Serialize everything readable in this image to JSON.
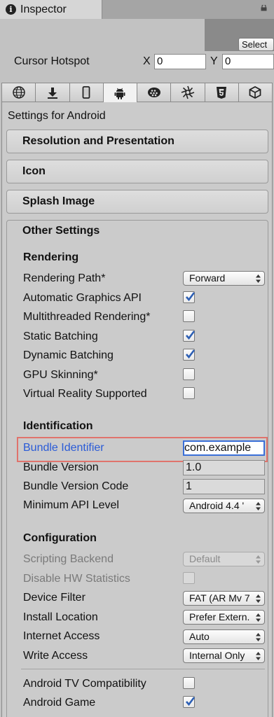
{
  "window": {
    "tab_title": "Inspector",
    "tab_icon": "info-icon",
    "lock_icon": "lock-icon"
  },
  "header": {
    "select_label": "Select",
    "cursor_hotspot_label": "Cursor Hotspot",
    "x_label": "X",
    "x_value": "0",
    "y_label": "Y",
    "y_value": "0"
  },
  "platform_tabs": [
    {
      "name": "web",
      "icon": "globe-icon"
    },
    {
      "name": "standalone",
      "icon": "download-icon"
    },
    {
      "name": "ios",
      "icon": "phone-icon"
    },
    {
      "name": "android",
      "icon": "android-icon",
      "active": true
    },
    {
      "name": "blackberry",
      "icon": "blackberry-icon"
    },
    {
      "name": "tizen",
      "icon": "tizen-icon"
    },
    {
      "name": "webgl",
      "icon": "html5-icon"
    },
    {
      "name": "other",
      "icon": "unity-cube-icon"
    }
  ],
  "settings": {
    "title": "Settings for Android",
    "sections": {
      "resolution": "Resolution and Presentation",
      "icon": "Icon",
      "splash": "Splash Image",
      "other": "Other Settings"
    },
    "rendering": {
      "heading": "Rendering",
      "rendering_path_label": "Rendering Path*",
      "rendering_path_value": "Forward",
      "auto_graphics_label": "Automatic Graphics API",
      "auto_graphics_checked": true,
      "multithreaded_label": "Multithreaded Rendering*",
      "multithreaded_checked": false,
      "static_batching_label": "Static Batching",
      "static_batching_checked": true,
      "dynamic_batching_label": "Dynamic Batching",
      "dynamic_batching_checked": true,
      "gpu_skinning_label": "GPU Skinning*",
      "gpu_skinning_checked": false,
      "vr_label": "Virtual Reality Supported",
      "vr_checked": false
    },
    "identification": {
      "heading": "Identification",
      "bundle_id_label": "Bundle Identifier",
      "bundle_id_value": "com.example",
      "bundle_version_label": "Bundle Version",
      "bundle_version_value": "1.0",
      "bundle_version_code_label": "Bundle Version Code",
      "bundle_version_code_value": "1",
      "min_api_label": "Minimum API Level",
      "min_api_value": "Android 4.4 '"
    },
    "configuration": {
      "heading": "Configuration",
      "scripting_backend_label": "Scripting Backend",
      "scripting_backend_value": "Default",
      "disable_hw_label": "Disable HW Statistics",
      "disable_hw_checked": false,
      "device_filter_label": "Device Filter",
      "device_filter_value": "FAT (AR Mv 7",
      "install_location_label": "Install Location",
      "install_location_value": "Prefer Extern.",
      "internet_access_label": "Internet Access",
      "internet_access_value": "Auto",
      "write_access_label": "Write Access",
      "write_access_value": "Internal Only",
      "android_tv_label": "Android TV Compatibility",
      "android_tv_checked": false,
      "android_game_label": "Android Game",
      "android_game_checked": true
    }
  },
  "colors": {
    "panel_bg": "#cbcbcb",
    "selected_label": "#2a5bd7",
    "highlight_border": "#e0736c",
    "focus_border": "#3a6fd8"
  }
}
